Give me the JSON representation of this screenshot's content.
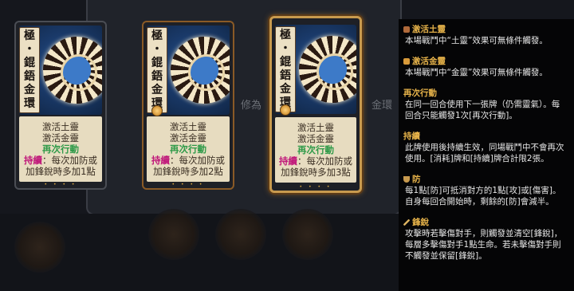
{
  "background": {
    "title_left": "修為",
    "title_right": "金環"
  },
  "cards": [
    {
      "name": "極・錕鋙金環",
      "name_chars": [
        "極",
        "・",
        "錕",
        "鋙",
        "金",
        "環"
      ],
      "line1": "激活土靈",
      "line2": "激活金靈",
      "line3": "再次行動",
      "keyword": "持續",
      "effect_a": "：每次加防或",
      "effect_b": "加鋒銳時多加1點",
      "dots": "• • • •"
    },
    {
      "name": "極・錕鋙金環",
      "name_chars": [
        "極",
        "・",
        "錕",
        "鋙",
        "金",
        "環"
      ],
      "line1": "激活土靈",
      "line2": "激活金靈",
      "line3": "再次行動",
      "keyword": "持續",
      "effect_a": "：每次加防或",
      "effect_b": "加鋒銳時多加2點",
      "dots": "• • • •"
    },
    {
      "name": "極・錕鋙金環",
      "name_chars": [
        "極",
        "・",
        "錕",
        "鋙",
        "金",
        "環"
      ],
      "line1": "激活土靈",
      "line2": "激活金靈",
      "line3": "再次行動",
      "keyword": "持續",
      "effect_a": "：每次加防或",
      "effect_b": "加鋒銳時多加3點",
      "dots": "• • • •"
    }
  ],
  "tooltip": [
    {
      "icon": "earth-spirit-icon",
      "title": "激活土靈",
      "body": "本場戰鬥中“土靈”效果可無條件觸發。"
    },
    {
      "icon": "gold-spirit-icon",
      "title": "激活金靈",
      "body": "本場戰鬥中“金靈”效果可無條件觸發。"
    },
    {
      "icon": "",
      "title": "再次行動",
      "body": "在同一回合使用下一張牌（仍需靈氣）。每回合只能觸發1次[再次行動]。"
    },
    {
      "icon": "",
      "title": "持續",
      "body": "此牌使用後持續生效，同場戰鬥中不會再次使用。[消耗]牌和[持續]牌合計限2張。"
    },
    {
      "icon": "shield-icon",
      "title": "防",
      "body": "每1點[防]可抵消對方的1點[攻]或[傷害]。自身每回合開始時，剩餘的[防]會減半。"
    },
    {
      "icon": "blade-icon",
      "title": "鋒銳",
      "body": "攻擊時若擊傷對手，則觸發並清空[鋒銳]，每層多擊傷對手1點生命。若未擊傷對手則不觸發並保留[鋒銳]。"
    }
  ],
  "colors": {
    "keyword_green": "#2e9a48",
    "keyword_magenta": "#c0187a",
    "tooltip_heading": "#e7b34a"
  }
}
